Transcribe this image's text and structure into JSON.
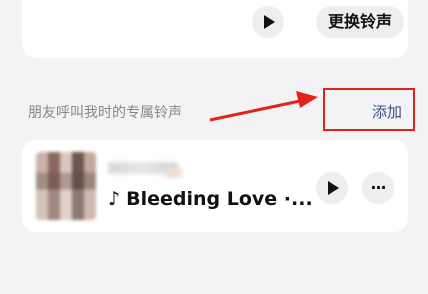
{
  "top_card": {
    "change_ringtone_label": "更换铃声",
    "play_icon": "play-icon"
  },
  "section": {
    "label": "朋友呼叫我时的专属铃声",
    "add_label": "添加",
    "highlight_color": "#e2231a",
    "arrow_icon": "annotation-arrow"
  },
  "song": {
    "note_icon": "♪",
    "title": "Bleeding Love ·...",
    "play_icon": "play-icon",
    "more_icon": "more-icon",
    "more_glyph": "···"
  }
}
